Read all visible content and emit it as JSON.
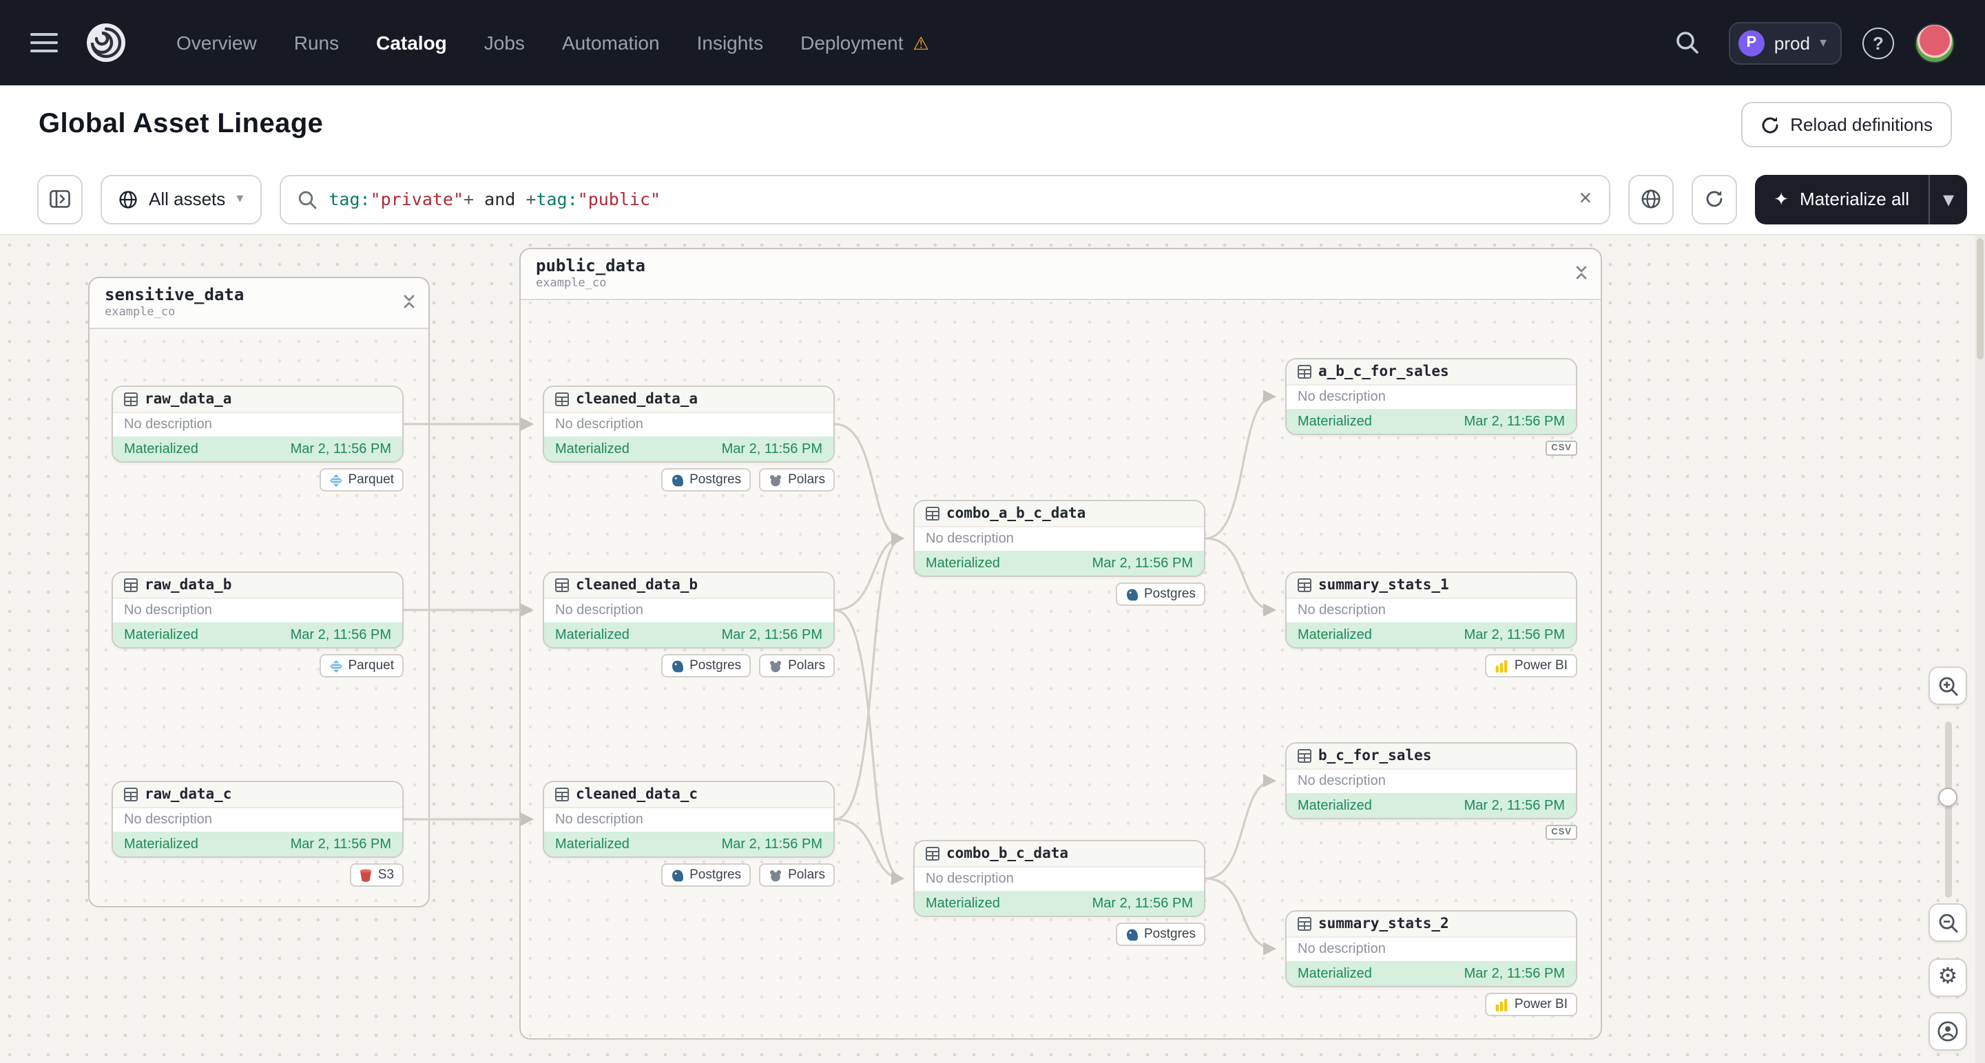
{
  "colors": {
    "nav_bg": "#171a22",
    "materialize_bg": "#1b1e27",
    "status_green_bg": "#d6efdf",
    "status_green_text": "#1d8a55",
    "warning_orange": "#efa62b",
    "deployment_badge_purple": "#7b5df0",
    "canvas_bg": "#f5f3ef"
  },
  "icons": {
    "sparkle": "✦",
    "caret_down": "▾",
    "close": "×",
    "warning": "⚠",
    "gear": "⚙",
    "help": "?"
  },
  "nav": {
    "items": [
      {
        "label": "Overview",
        "active": false
      },
      {
        "label": "Runs",
        "active": false
      },
      {
        "label": "Catalog",
        "active": true
      },
      {
        "label": "Jobs",
        "active": false
      },
      {
        "label": "Automation",
        "active": false
      },
      {
        "label": "Insights",
        "active": false
      },
      {
        "label": "Deployment",
        "active": false,
        "warning": true
      }
    ],
    "deployment": {
      "initial": "P",
      "name": "prod"
    }
  },
  "header": {
    "title": "Global Asset Lineage",
    "reload_label": "Reload definitions"
  },
  "toolbar": {
    "scope_label": "All assets",
    "query_parts": [
      {
        "text": "tag:",
        "kind": "key"
      },
      {
        "text": "\"private\"",
        "kind": "string"
      },
      {
        "text": "+",
        "kind": "op"
      },
      {
        "text": " and ",
        "kind": "plain"
      },
      {
        "text": "+",
        "kind": "op"
      },
      {
        "text": "tag:",
        "kind": "key"
      },
      {
        "text": "\"public\"",
        "kind": "string"
      }
    ],
    "materialize_label": "Materialize all"
  },
  "graph": {
    "groups": [
      {
        "name": "sensitive_data",
        "subtitle": "example_co"
      },
      {
        "name": "public_data",
        "subtitle": "example_co"
      }
    ],
    "defaults": {
      "description": "No description",
      "status": "Materialized",
      "timestamp": "Mar 2, 11:56 PM"
    },
    "nodes": [
      {
        "name": "raw_data_a",
        "tags": [
          "Parquet"
        ]
      },
      {
        "name": "raw_data_b",
        "tags": [
          "Parquet"
        ]
      },
      {
        "name": "raw_data_c",
        "tags": [
          "S3"
        ]
      },
      {
        "name": "cleaned_data_a",
        "tags": [
          "Postgres",
          "Polars"
        ]
      },
      {
        "name": "cleaned_data_b",
        "tags": [
          "Postgres",
          "Polars"
        ]
      },
      {
        "name": "cleaned_data_c",
        "tags": [
          "Postgres",
          "Polars"
        ]
      },
      {
        "name": "combo_a_b_c_data",
        "tags": [
          "Postgres"
        ]
      },
      {
        "name": "combo_b_c_data",
        "tags": [
          "Postgres"
        ]
      },
      {
        "name": "a_b_c_for_sales",
        "tags": [],
        "file_badge": "CSV"
      },
      {
        "name": "summary_stats_1",
        "tags": [
          "Power BI"
        ]
      },
      {
        "name": "b_c_for_sales",
        "tags": [],
        "file_badge": "CSV"
      },
      {
        "name": "summary_stats_2",
        "tags": [
          "Power BI"
        ]
      }
    ]
  }
}
